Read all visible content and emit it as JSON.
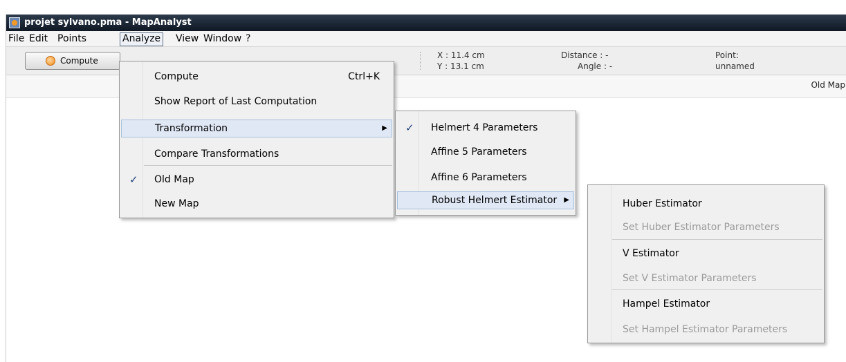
{
  "window": {
    "title": "projet sylvano.pma - MapAnalyst"
  },
  "menubar": {
    "items": [
      "File",
      "Edit",
      "Points",
      "Analyze",
      "View",
      "Window",
      "?"
    ]
  },
  "toolbar": {
    "compute_label": "Compute",
    "x": "X : 11.4 cm",
    "y": "Y : 13.1 cm",
    "distance": "Distance : -",
    "angle": "Angle : -",
    "point_label": "Point:",
    "point_value": "unnamed"
  },
  "substrip": {
    "old_map_label": "Old Map"
  },
  "analyze_menu": {
    "compute": "Compute",
    "compute_shortcut": "Ctrl+K",
    "show_report": "Show Report of Last Computation",
    "transformation": "Transformation",
    "compare": "Compare Transformations",
    "old_map": "Old Map",
    "new_map": "New Map"
  },
  "transformation_menu": {
    "helmert4": "Helmert 4 Parameters",
    "affine5": "Affine 5 Parameters",
    "affine6": "Affine 6 Parameters",
    "robust_helmert": "Robust Helmert Estimator"
  },
  "robust_menu": {
    "huber": "Huber Estimator",
    "huber_params": "Set Huber Estimator Parameters",
    "v": "V Estimator",
    "v_params": "Set V Estimator Parameters",
    "hampel": "Hampel Estimator",
    "hampel_params": "Set Hampel Estimator Parameters"
  },
  "icons": {
    "app": "java-cup-icon",
    "compute": "compute-icon",
    "check": "checkmark-icon",
    "submenu": "submenu-arrow-icon"
  },
  "colors": {
    "titlebar": "#1a2433",
    "menu_highlight": "#dfe8f4",
    "check": "#1d3f7a"
  }
}
